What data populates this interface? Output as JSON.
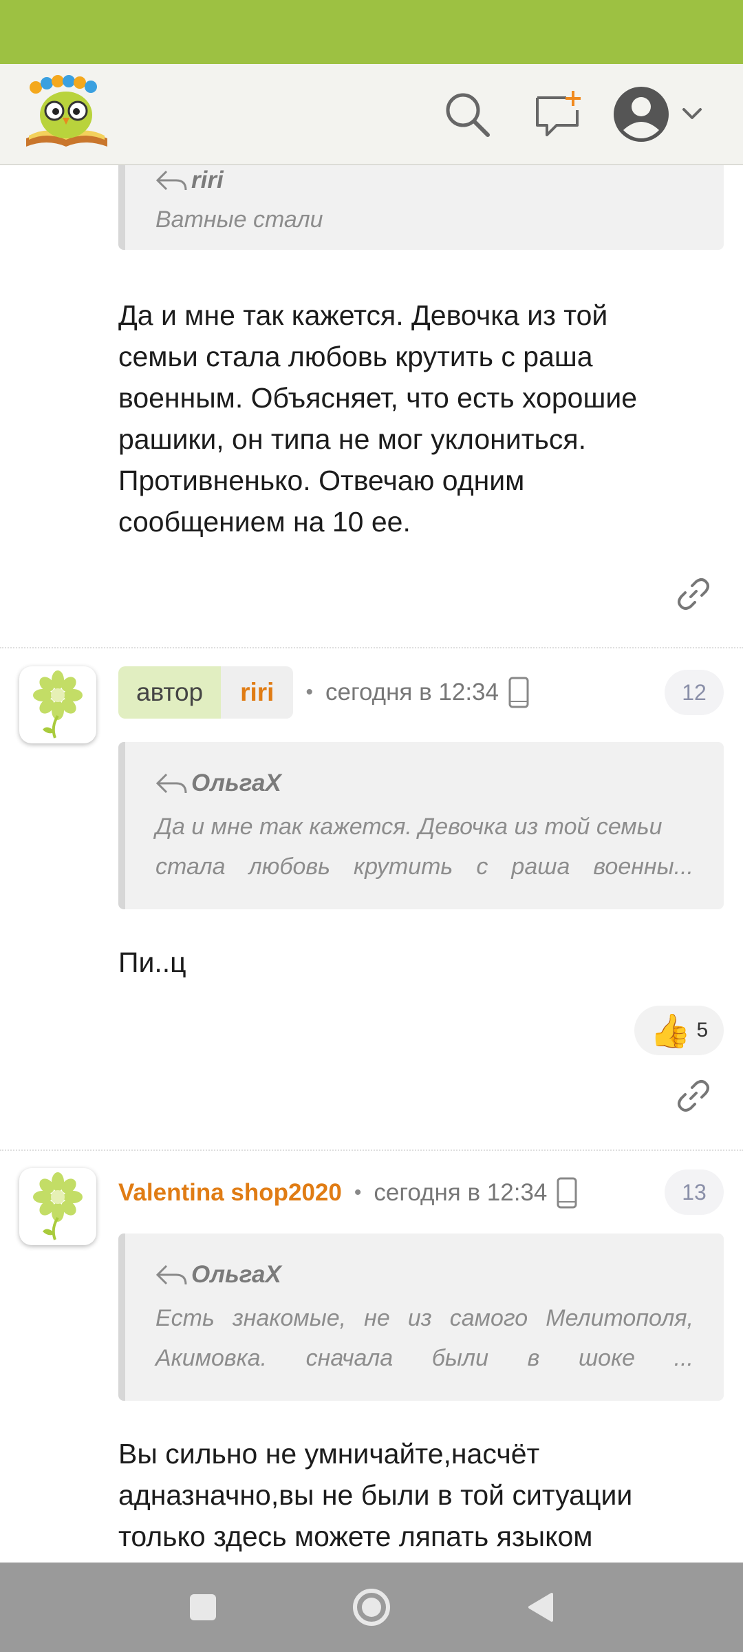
{
  "header": {
    "logo_icon": "owl-on-book-logo",
    "search_icon": "search-icon",
    "compose_icon": "new-message-icon",
    "profile_icon": "user-avatar-icon"
  },
  "posts": [
    {
      "quote_author": "riri",
      "quote_text": "Ватные стали",
      "text_lines": [
        "Да и мне так кажется. Девочка из той",
        "семьи стала любовь крутить с раша",
        "военным. Объясняет, что есть хорошие",
        "рашики, он типа не мог уклониться.",
        "Противненько. Отвечаю одним",
        "сообщением на 10 ее."
      ]
    },
    {
      "author_badge": "автор",
      "username": "riri",
      "time": "сегодня в 12:34",
      "number": "12",
      "quote_author": "ОльгаХ",
      "quote_lines": [
        "Да и мне так кажется. Девочка из той семьи",
        "стала любовь крутить с раша военны..."
      ],
      "text": "Пи..ц",
      "reaction_emoji": "👍",
      "reaction_count": "5"
    },
    {
      "username": "Valentina shop2020",
      "time": "сегодня в 12:34",
      "number": "13",
      "quote_author": "ОльгаХ",
      "quote_lines": [
        "Есть знакомые, не из самого Мелитополя,",
        "Акимовка. сначала были в шоке ..."
      ],
      "text_lines": [
        "Вы сильно не умничайте,насчёт",
        "адназначно,вы не были в той ситуации",
        "только здесь можете ляпать языком"
      ]
    }
  ],
  "colors": {
    "status_bar": "#9dc142",
    "accent_orange": "#e07c14",
    "author_badge_bg": "#e1eec1"
  }
}
